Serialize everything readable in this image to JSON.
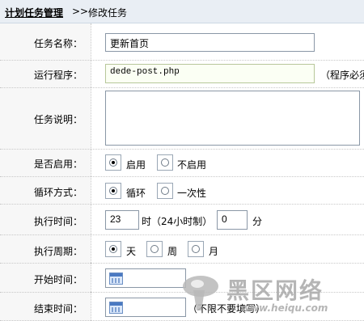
{
  "breadcrumb": {
    "link": "计划任务管理",
    "sep": ">>",
    "current": "修改任务"
  },
  "form": {
    "task_name": {
      "label": "任务名称：",
      "value": "更新首页"
    },
    "program": {
      "label": "运行程序：",
      "value": "dede-post.php",
      "note": "（程序必须"
    },
    "description": {
      "label": "任务说明：",
      "value": ""
    },
    "enabled": {
      "label": "是否启用：",
      "options": [
        "启用",
        "不启用"
      ],
      "selected": "启用"
    },
    "loop_mode": {
      "label": "循环方式：",
      "options": [
        "循环",
        "一次性"
      ],
      "selected": "循环"
    },
    "exec_time": {
      "label": "执行时间：",
      "hour": "23",
      "hour_unit": "时（24小时制）",
      "minute": "0",
      "minute_unit": "分"
    },
    "period": {
      "label": "执行周期：",
      "options": [
        "天",
        "周",
        "月"
      ],
      "selected": "天"
    },
    "start_time": {
      "label": "开始时间：",
      "value": ""
    },
    "end_time": {
      "label": "结束时间：",
      "value": "",
      "note": "（不限不要填写）"
    }
  },
  "watermark": {
    "cn": "黑区网络",
    "url": "www.heiqu.com"
  },
  "colors": {
    "header_bg": "#e9eef4",
    "label_bg": "#f7f7f7",
    "input_border": "#8a97a6"
  }
}
